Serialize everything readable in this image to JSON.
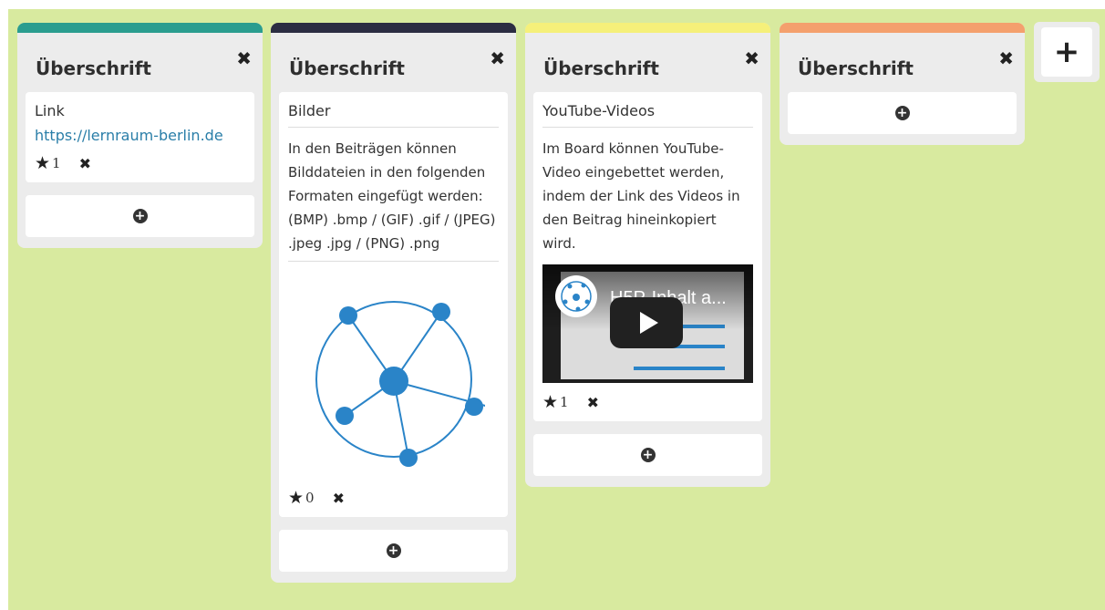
{
  "colors": {
    "board_bg": "#d8ea9f",
    "column_bg": "#ececec",
    "bar_teal": "#2a9d8f",
    "bar_navy": "#2b2d42",
    "bar_yellow": "#f5f07a",
    "bar_orange": "#f4a06d",
    "link": "#2a7ea8",
    "diagram": "#2a84c8"
  },
  "icons": {
    "close": "close-icon",
    "star": "star-icon",
    "delete": "delete-icon",
    "add": "plus-circle-icon",
    "add_column": "plus-icon"
  },
  "columns": [
    {
      "title": "Überschrift",
      "cards": [
        {
          "title": "Link",
          "link": "https://lernraum-berlin.de",
          "stars": "1"
        }
      ]
    },
    {
      "title": "Überschrift",
      "cards": [
        {
          "title": "Bilder",
          "body": "In den Beiträgen können Bilddateien in den folgenden Formaten eingefügt werden: (BMP) .bmp / (GIF) .gif / (JPEG) .jpeg .jpg / (PNG) .png",
          "stars": "0"
        }
      ]
    },
    {
      "title": "Überschrift",
      "cards": [
        {
          "title": "YouTube-Videos",
          "body": "Im Board können YouTube-Video eingebettet werden, indem der Link des Videos in den Beitrag hineinkopiert wird.",
          "video_title": "H5P-Inhalt a...",
          "stars": "1"
        }
      ]
    },
    {
      "title": "Überschrift",
      "cards": []
    }
  ],
  "glyphs": {
    "close": "✖",
    "star": "★",
    "delete": "✖",
    "add": "+",
    "add_column": "+"
  }
}
